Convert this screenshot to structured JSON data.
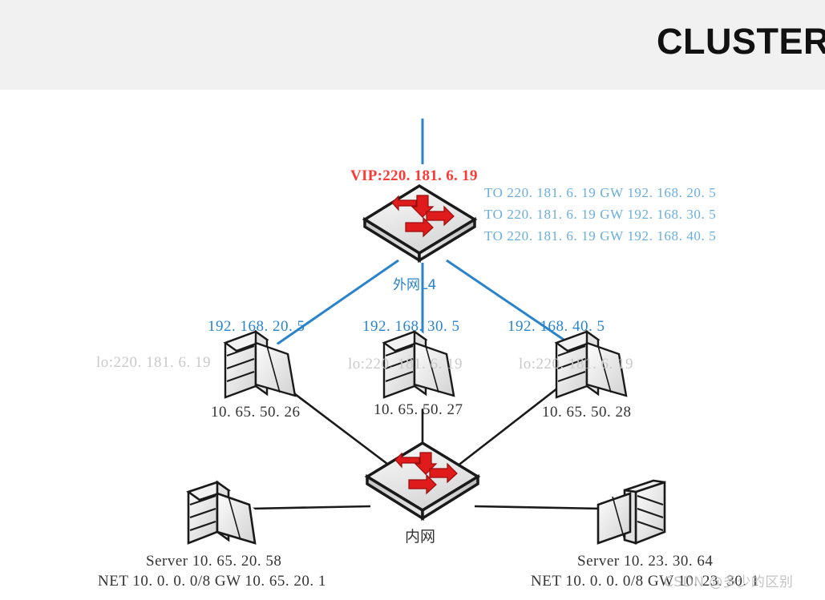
{
  "header": {
    "title": "CLUSTER",
    "background_color": "#f1f1f1"
  },
  "colors": {
    "vip_red": "#fb3a36",
    "link_blue": "#2a84cc",
    "route_blue": "#6aaee0",
    "loopback_gray": "#c9c9c9",
    "label_black": "#333333",
    "arrow_red": "#e01b1b"
  },
  "diagram": {
    "type": "network-topology",
    "uplink": {
      "vip_label": "VIP:220. 181. 6. 19"
    },
    "external_switch": {
      "name": "外网L4",
      "icon": "switch-icon",
      "routes": [
        "TO  220. 181. 6. 19  GW  192. 168. 20. 5",
        "TO  220. 181. 6. 19  GW  192. 168. 30. 5",
        "TO  220. 181. 6. 19  GW  192. 168. 40. 5"
      ]
    },
    "internal_switch": {
      "name": "内网",
      "icon": "switch-icon"
    },
    "lvs_nodes": [
      {
        "icon": "server-icon",
        "outer_ip": "192. 168. 20. 5",
        "loopback": "lo:220. 181. 6. 19",
        "inner_ip": "10. 65. 50. 26"
      },
      {
        "icon": "server-icon",
        "outer_ip": "192. 168. 30. 5",
        "loopback": "lo:220. 181. 6. 19",
        "inner_ip": "10. 65. 50. 27"
      },
      {
        "icon": "server-icon",
        "outer_ip": "192. 168. 40. 5",
        "loopback": "lo:220. 181. 6. 19",
        "inner_ip": "10. 65. 50. 28"
      }
    ],
    "backend_servers": [
      {
        "icon": "server-icon",
        "title": "Server  10. 65. 20. 58",
        "route": "NET  10. 0. 0. 0/8  GW  10. 65. 20. 1"
      },
      {
        "icon": "server-icon",
        "title": "Server  10. 23. 30. 64",
        "route": "NET  10. 0. 0. 0/8  GW  10. 23. 30. 1"
      }
    ]
  },
  "watermark": {
    "text": "CSDN @多少的区别"
  }
}
